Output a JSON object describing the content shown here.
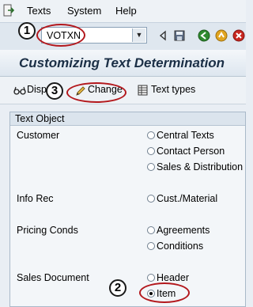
{
  "menu": {
    "items": [
      "Texts",
      "System",
      "Help"
    ]
  },
  "toolbar": {
    "command_value": "VOTXN"
  },
  "title": "Customizing Text Determination",
  "app_toolbar": {
    "display_label": "Disp",
    "change_label": "Change",
    "text_types_label": "Text types"
  },
  "text_object": {
    "header": "Text Object",
    "groups": [
      {
        "label": "Customer",
        "options": [
          "Central Texts",
          "Contact Person",
          "Sales & Distribution"
        ]
      },
      {
        "label": "Info Rec",
        "options": [
          "Cust./Material"
        ]
      },
      {
        "label": "Pricing Conds",
        "options": [
          "Agreements",
          "Conditions"
        ]
      },
      {
        "label": "Sales Document",
        "options": [
          "Header",
          "Item"
        ],
        "selected": "Item"
      }
    ]
  },
  "annotations": {
    "step1": "1",
    "step2": "2",
    "step3": "3",
    "color": "#b3181d"
  }
}
